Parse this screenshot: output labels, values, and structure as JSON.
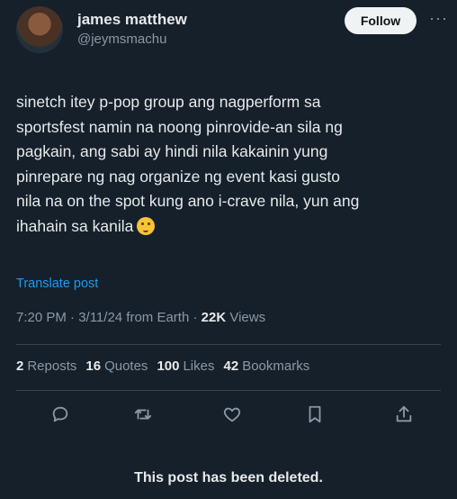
{
  "author": {
    "name": "james matthew",
    "handle": "@jeymsmachu"
  },
  "follow_label": "Follow",
  "more_label": "···",
  "post_text": "sinetch itey p-pop group ang nagperform sa\nsportsfest namin na noong pinrovide-an sila ng\npagkain, ang sabi ay hindi nila kakainin yung\npinrepare ng nag organize ng event kasi gusto\nnila na on the spot kung ano i-crave nila, yun ang\nihahain sa kanila",
  "translate_label": "Translate post",
  "meta": {
    "time": "7:20 PM · 3/11/24 from Earth · ",
    "views_count": "22K",
    "views_label": " Views"
  },
  "stats": [
    {
      "count": "2",
      "label": "Reposts"
    },
    {
      "count": "16",
      "label": "Quotes"
    },
    {
      "count": "100",
      "label": "Likes"
    },
    {
      "count": "42",
      "label": "Bookmarks"
    }
  ],
  "icons": [
    "reply-icon",
    "repost-icon",
    "like-icon",
    "bookmark-icon",
    "share-icon"
  ],
  "deleted_notice": "This post has been deleted.",
  "colors": {
    "background": "#15202b",
    "text": "#e7e9ea",
    "muted": "#8b98a5",
    "link": "#1d9bf0"
  }
}
